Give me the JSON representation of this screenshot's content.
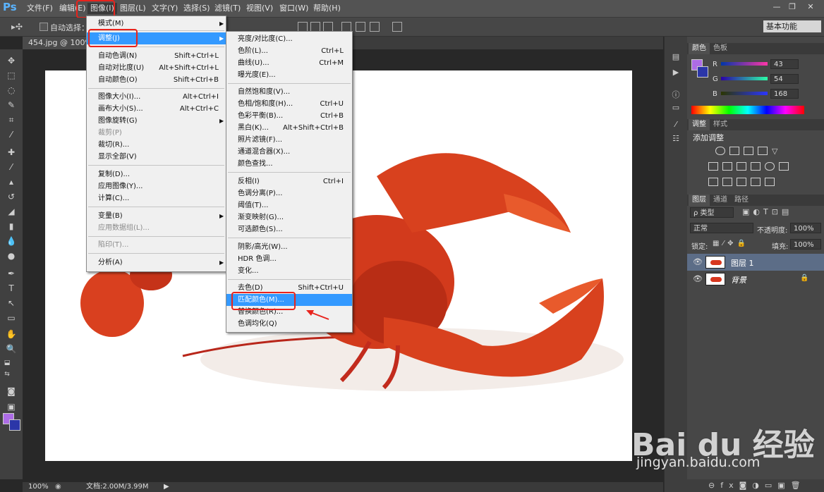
{
  "app": {
    "logo": "Ps"
  },
  "menubar": {
    "items": [
      "文件(F)",
      "编辑(E)",
      "图像(I)",
      "图层(L)",
      "文字(Y)",
      "选择(S)",
      "滤镜(T)",
      "视图(V)",
      "窗口(W)",
      "帮助(H)"
    ],
    "window_controls": [
      "—",
      "❐",
      "✕"
    ]
  },
  "options_bar": {
    "auto_select_label": "自动选择：",
    "workspace": "基本功能"
  },
  "document": {
    "tab_label": "454.jpg @ 100% (图",
    "zoom": "100%",
    "doc_info": "文档:2.00M/3.99M"
  },
  "image_menu": {
    "items": [
      {
        "label": "模式(M)",
        "shortcut": "",
        "submenu": true
      },
      {
        "label": "调整(J)",
        "shortcut": "",
        "submenu": true
      },
      {
        "label": "自动色调(N)",
        "shortcut": "Shift+Ctrl+L"
      },
      {
        "label": "自动对比度(U)",
        "shortcut": "Alt+Shift+Ctrl+L"
      },
      {
        "label": "自动颜色(O)",
        "shortcut": "Shift+Ctrl+B"
      },
      {
        "label": "图像大小(I)...",
        "shortcut": "Alt+Ctrl+I"
      },
      {
        "label": "画布大小(S)...",
        "shortcut": "Alt+Ctrl+C"
      },
      {
        "label": "图像旋转(G)",
        "shortcut": "",
        "submenu": true
      },
      {
        "label": "裁剪(P)",
        "shortcut": "",
        "disabled": true
      },
      {
        "label": "裁切(R)...",
        "shortcut": ""
      },
      {
        "label": "显示全部(V)",
        "shortcut": ""
      },
      {
        "label": "复制(D)...",
        "shortcut": ""
      },
      {
        "label": "应用图像(Y)...",
        "shortcut": ""
      },
      {
        "label": "计算(C)...",
        "shortcut": ""
      },
      {
        "label": "变量(B)",
        "shortcut": "",
        "submenu": true
      },
      {
        "label": "应用数据组(L)...",
        "shortcut": "",
        "disabled": true
      },
      {
        "label": "陷印(T)...",
        "shortcut": "",
        "disabled": true
      },
      {
        "label": "分析(A)",
        "shortcut": "",
        "submenu": true
      }
    ]
  },
  "adjust_menu": {
    "items": [
      {
        "label": "亮度/对比度(C)...",
        "shortcut": ""
      },
      {
        "label": "色阶(L)...",
        "shortcut": "Ctrl+L"
      },
      {
        "label": "曲线(U)...",
        "shortcut": "Ctrl+M"
      },
      {
        "label": "曝光度(E)...",
        "shortcut": ""
      },
      {
        "label": "自然饱和度(V)...",
        "shortcut": ""
      },
      {
        "label": "色相/饱和度(H)...",
        "shortcut": "Ctrl+U"
      },
      {
        "label": "色彩平衡(B)...",
        "shortcut": "Ctrl+B"
      },
      {
        "label": "黑白(K)...",
        "shortcut": "Alt+Shift+Ctrl+B"
      },
      {
        "label": "照片滤镜(F)...",
        "shortcut": ""
      },
      {
        "label": "通道混合器(X)...",
        "shortcut": ""
      },
      {
        "label": "颜色查找...",
        "shortcut": ""
      },
      {
        "label": "反相(I)",
        "shortcut": "Ctrl+I"
      },
      {
        "label": "色调分离(P)...",
        "shortcut": ""
      },
      {
        "label": "阈值(T)...",
        "shortcut": ""
      },
      {
        "label": "渐变映射(G)...",
        "shortcut": ""
      },
      {
        "label": "可选颜色(S)...",
        "shortcut": ""
      },
      {
        "label": "阴影/高光(W)...",
        "shortcut": ""
      },
      {
        "label": "HDR 色调...",
        "shortcut": ""
      },
      {
        "label": "变化...",
        "shortcut": ""
      },
      {
        "label": "去色(D)",
        "shortcut": "Shift+Ctrl+U"
      },
      {
        "label": "匹配颜色(M)...",
        "shortcut": "",
        "highlighted": true
      },
      {
        "label": "替换颜色(R)...",
        "shortcut": ""
      },
      {
        "label": "色调均化(Q)",
        "shortcut": ""
      }
    ]
  },
  "color_panel": {
    "tabs": [
      "颜色",
      "色板"
    ],
    "r": "43",
    "g": "54",
    "b": "168",
    "r_label": "R",
    "g_label": "G",
    "b_label": "B",
    "foreground_color": "#ad6ce6",
    "background_color": "#2b36a8"
  },
  "adjustments_panel": {
    "tabs": [
      "调整",
      "样式"
    ],
    "title": "添加调整"
  },
  "layers_panel": {
    "tabs": [
      "图层",
      "通道",
      "路径"
    ],
    "filter_kind": "ρ 类型",
    "blend_mode": "正常",
    "opacity_label": "不透明度:",
    "opacity": "100%",
    "lock_label": "锁定:",
    "fill_label": "填充:",
    "fill": "100%",
    "layers": [
      {
        "name": "图层 1",
        "selected": true
      },
      {
        "name": "背景",
        "selected": false,
        "locked": true
      }
    ]
  },
  "watermark": {
    "brand": "Bai du 经验",
    "url": "jingyan.baidu.com"
  }
}
